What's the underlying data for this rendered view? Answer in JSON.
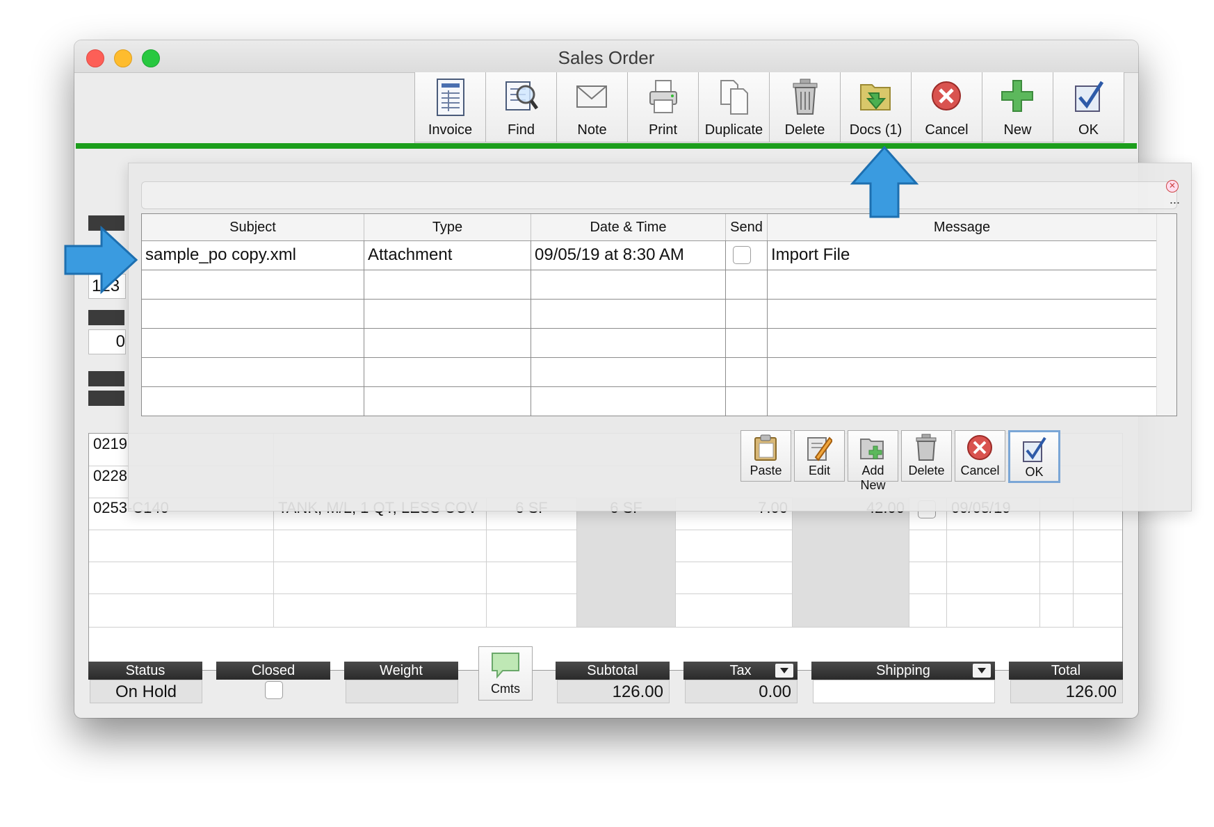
{
  "window": {
    "title": "Sales Order"
  },
  "toolbar": [
    {
      "label": "Invoice",
      "icon": "invoice-icon"
    },
    {
      "label": "Find",
      "icon": "find-icon"
    },
    {
      "label": "Note",
      "icon": "note-icon"
    },
    {
      "label": "Print",
      "icon": "printer-icon"
    },
    {
      "label": "Duplicate",
      "icon": "duplicate-icon"
    },
    {
      "label": "Delete",
      "icon": "trash-icon"
    },
    {
      "label": "Docs (1)",
      "icon": "docs-folder-icon"
    },
    {
      "label": "Cancel",
      "icon": "cancel-icon"
    },
    {
      "label": "New",
      "icon": "plus-icon"
    },
    {
      "label": "OK",
      "icon": "checkmark-icon"
    }
  ],
  "background": {
    "field_fragments": [
      "123",
      "0"
    ],
    "line_items": [
      {
        "item": "0219",
        "desc": "",
        "qty": "",
        "qty2": "",
        "price": "",
        "ext": "",
        "date": ""
      },
      {
        "item": "0228",
        "desc": "",
        "qty": "",
        "qty2": "",
        "price": "",
        "ext": "",
        "date": ""
      },
      {
        "item": "0253-C140",
        "desc": "TANK, M/L, 1 QT, LESS COV",
        "qty": "6 SF",
        "qty2": "6 SF",
        "price": "7.00",
        "ext": "42.00",
        "date": "09/05/19"
      }
    ]
  },
  "footer": {
    "status_label": "Status",
    "status_value": "On Hold",
    "closed_label": "Closed",
    "weight_label": "Weight",
    "weight_value": "",
    "cmts_label": "Cmts",
    "subtotal_label": "Subtotal",
    "subtotal_value": "126.00",
    "tax_label": "Tax",
    "tax_value": "0.00",
    "shipping_label": "Shipping",
    "shipping_value": "",
    "total_label": "Total",
    "total_value": "126.00"
  },
  "docs_panel": {
    "columns": [
      "Subject",
      "Type",
      "Date & Time",
      "Send",
      "Message"
    ],
    "rows": [
      {
        "subject": "sample_po copy.xml",
        "type": "Attachment",
        "datetime": "09/05/19 at 8:30 AM",
        "send": false,
        "message": "Import File"
      }
    ],
    "more_label": "...",
    "buttons": [
      {
        "label": "Paste",
        "icon": "clipboard-paste-icon"
      },
      {
        "label": "Edit",
        "icon": "edit-pencil-icon"
      },
      {
        "label": "Add New",
        "icon": "add-new-icon"
      },
      {
        "label": "Delete",
        "icon": "trash-icon"
      },
      {
        "label": "Cancel",
        "icon": "cancel-icon"
      },
      {
        "label": "OK",
        "icon": "checkmark-icon"
      }
    ]
  },
  "colors": {
    "accent_bar": "#1c9e1c",
    "callout_arrow": "#3a9be0",
    "default_button_border": "#7aa6d6"
  }
}
